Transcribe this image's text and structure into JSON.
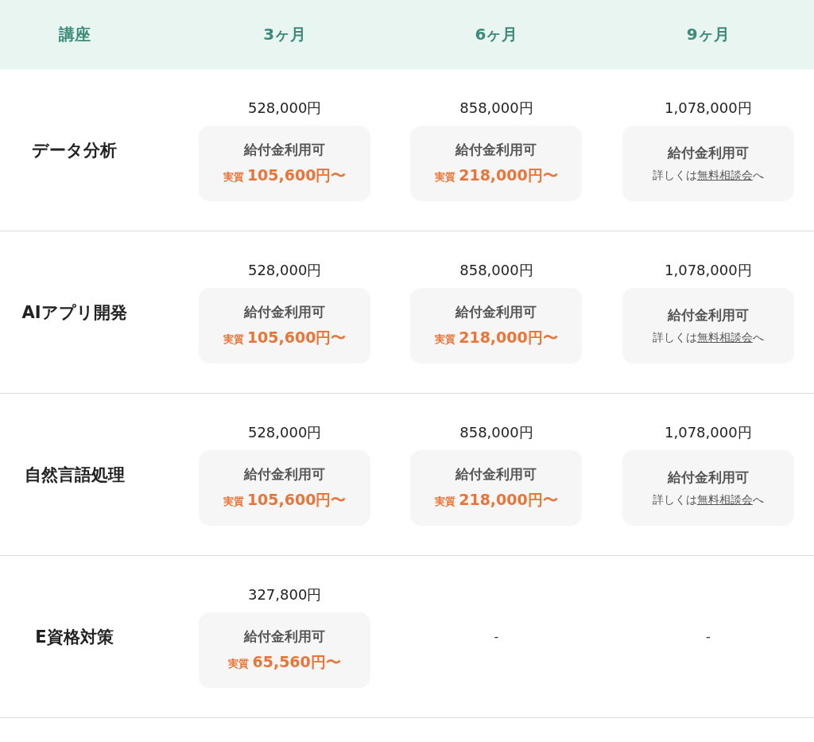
{
  "columns": [
    "講座",
    "3ヶ月",
    "6ヶ月",
    "9ヶ月"
  ],
  "rows": [
    {
      "name": "データ分析",
      "cells": [
        {
          "kind": "price",
          "price": "528,000円",
          "badge": "給付金利用可",
          "prefix": "実質",
          "amount": "105,600円〜"
        },
        {
          "kind": "price",
          "price": "858,000円",
          "badge": "給付金利用可",
          "prefix": "実質",
          "amount": "218,000円〜"
        },
        {
          "kind": "consult",
          "price": "1,078,000円",
          "badge": "給付金利用可",
          "before": "詳しくは",
          "link": "無料相談会",
          "after": "へ"
        }
      ]
    },
    {
      "name": "AIアプリ開発",
      "cells": [
        {
          "kind": "price",
          "price": "528,000円",
          "badge": "給付金利用可",
          "prefix": "実質",
          "amount": "105,600円〜"
        },
        {
          "kind": "price",
          "price": "858,000円",
          "badge": "給付金利用可",
          "prefix": "実質",
          "amount": "218,000円〜"
        },
        {
          "kind": "consult",
          "price": "1,078,000円",
          "badge": "給付金利用可",
          "before": "詳しくは",
          "link": "無料相談会",
          "after": "へ"
        }
      ]
    },
    {
      "name": "自然言語処理",
      "cells": [
        {
          "kind": "price",
          "price": "528,000円",
          "badge": "給付金利用可",
          "prefix": "実質",
          "amount": "105,600円〜"
        },
        {
          "kind": "price",
          "price": "858,000円",
          "badge": "給付金利用可",
          "prefix": "実質",
          "amount": "218,000円〜"
        },
        {
          "kind": "consult",
          "price": "1,078,000円",
          "badge": "給付金利用可",
          "before": "詳しくは",
          "link": "無料相談会",
          "after": "へ"
        }
      ]
    },
    {
      "name": "E資格対策",
      "cells": [
        {
          "kind": "price",
          "price": "327,800円",
          "badge": "給付金利用可",
          "prefix": "実質",
          "amount": "65,560円〜"
        },
        {
          "kind": "empty",
          "text": "-"
        },
        {
          "kind": "empty",
          "text": "-"
        }
      ]
    }
  ]
}
